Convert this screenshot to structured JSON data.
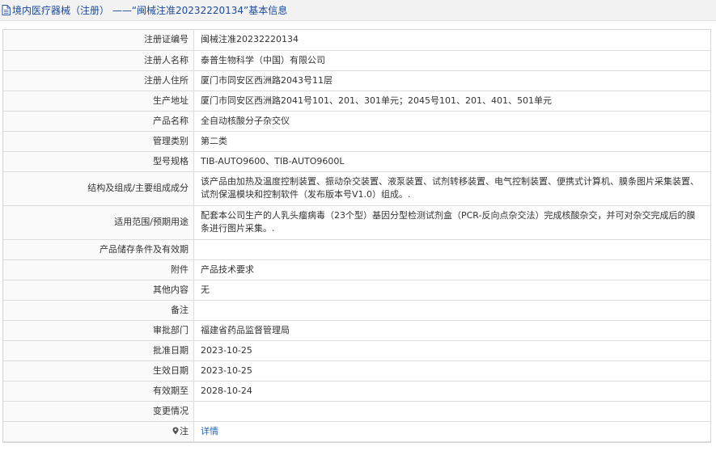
{
  "header": {
    "title": "境内医疗器械（注册） ——“闽械注准20232220134”基本信息"
  },
  "rows": [
    {
      "label": "注册证编号",
      "value": "闽械注准20232220134"
    },
    {
      "label": "注册人名称",
      "value": "泰普生物科学（中国）有限公司"
    },
    {
      "label": "注册人住所",
      "value": "厦门市同安区西洲路2043号11层"
    },
    {
      "label": "生产地址",
      "value": "厦门市同安区西洲路2041号101、201、301单元；2045号101、201、401、501单元"
    },
    {
      "label": "产品名称",
      "value": "全自动核酸分子杂交仪"
    },
    {
      "label": "管理类别",
      "value": "第二类"
    },
    {
      "label": "型号规格",
      "value": "TIB-AUTO9600、TIB-AUTO9600L"
    },
    {
      "label": "结构及组成/主要组成成分",
      "value": "该产品由加热及温度控制装置、振动杂交装置、液泵装置、试剂转移装置、电气控制装置、便携式计算机、膜条图片采集装置、试剂保温模块和控制软件（发布版本号V1.0）组成。."
    },
    {
      "label": "适用范围/预期用途",
      "value": "配套本公司生产的人乳头瘤病毒（23个型）基因分型检测试剂盒（PCR-反向点杂交法）完成核酸杂交，并可对杂交完成后的膜条进行图片采集。."
    },
    {
      "label": "产品储存条件及有效期",
      "value": ""
    },
    {
      "label": "附件",
      "value": "产品技术要求"
    },
    {
      "label": "其他内容",
      "value": "无"
    },
    {
      "label": "备注",
      "value": ""
    },
    {
      "label": "审批部门",
      "value": "福建省药品监督管理局"
    },
    {
      "label": "批准日期",
      "value": "2023-10-25"
    },
    {
      "label": "生效日期",
      "value": "2023-10-25"
    },
    {
      "label": "有效期至",
      "value": "2028-10-24"
    },
    {
      "label": "变更情况",
      "value": ""
    }
  ],
  "note_row": {
    "label": "注",
    "link": "详情",
    "icon": "location-pin-icon"
  },
  "colors": {
    "header_text": "#1a4a99",
    "link": "#1a66c2",
    "label_bg": "#fafafa",
    "border": "#dddddd"
  }
}
